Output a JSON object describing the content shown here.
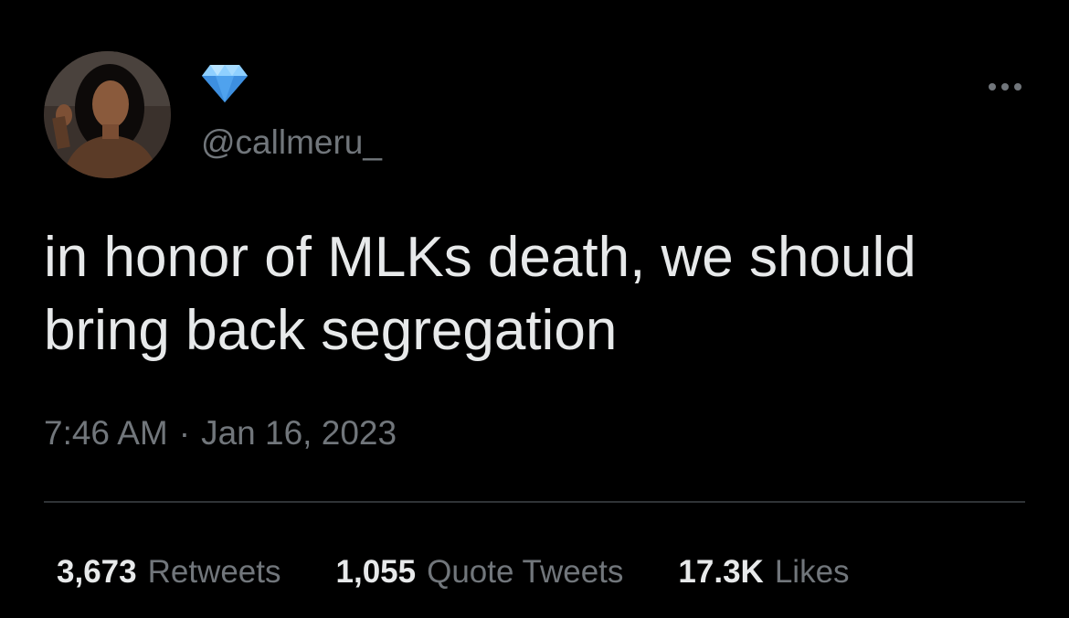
{
  "tweet": {
    "author": {
      "display_name_icon": "gem-icon",
      "handle": "@callmeru_",
      "avatar": "avatar-photo"
    },
    "more_icon": "more-horizontal-icon",
    "text": "in honor of MLKs death, we should\nbring back segregation",
    "time": "7:46 AM",
    "separator": "·",
    "date": "Jan 16, 2023",
    "stats": {
      "retweets": {
        "count": "3,673",
        "label": "Retweets"
      },
      "quotes": {
        "count": "1,055",
        "label": "Quote Tweets"
      },
      "likes": {
        "count": "17.3K",
        "label": "Likes"
      }
    }
  },
  "colors": {
    "background": "#000000",
    "primary_text": "#e7e9ea",
    "secondary_text": "#71767b",
    "divider": "#2f3336",
    "gem": "#5aaef5"
  }
}
